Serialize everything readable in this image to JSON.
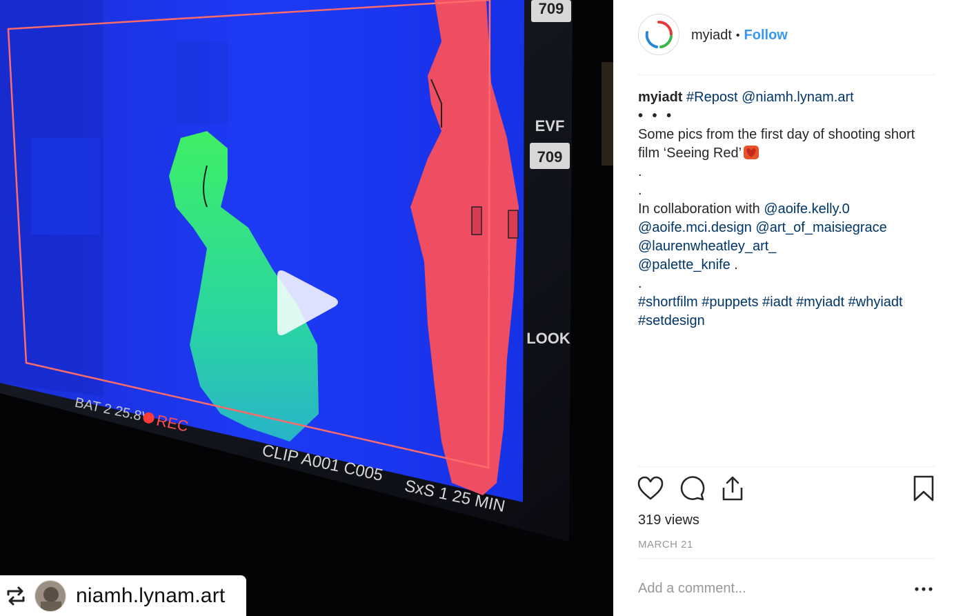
{
  "post": {
    "media": {
      "type": "video",
      "overlay_texts": {
        "frame_top": "709",
        "evf": "EVF",
        "evf_value": "709",
        "look": "LOOK",
        "battery": "BAT 2 25.8V",
        "rec": "REC",
        "clip": "CLIP A001 C005",
        "media_remaining": "SxS 1 25 MIN"
      },
      "repost_tag": {
        "username": "niamh.lynam.art",
        "icon": "repost-icon"
      },
      "play_icon": "play-icon"
    },
    "header": {
      "username": "myiadt",
      "separator": "•",
      "follow_label": "Follow"
    },
    "caption": {
      "username": "myiadt",
      "line1_tag": "#Repost",
      "line1_mention": "@niamh.lynam.art",
      "dots": "• • •",
      "text1": "Some pics from the first day of shooting short",
      "text2": "film ‘Seeing Red’",
      "period1": ".",
      "period2": ".",
      "collab_text": "In collaboration with",
      "mention1": "@aoife.kelly.0",
      "mention2": "@aoife.mci.design",
      "mention3": "@art_of_maisiegrace",
      "mention4": "@laurenwheatley_art_",
      "mention5": "@palette_knife",
      "mention5_suffix": " .",
      "period3": ".",
      "hashtags_line1": [
        "#shortfilm",
        "#puppets",
        "#iadt",
        "#myiadt",
        "#whyiadt"
      ],
      "hashtags_line2": [
        "#setdesign"
      ]
    },
    "stats": {
      "views": "319 views",
      "date": "MARCH 21"
    },
    "comment": {
      "placeholder": "Add a comment..."
    },
    "icons": {
      "like": "heart-icon",
      "comment": "comment-icon",
      "share": "share-icon",
      "save": "bookmark-icon",
      "more": "more-options-icon"
    },
    "colors": {
      "follow": "#3897f0",
      "link": "#003569",
      "muted": "#999999",
      "divider": "#efefef"
    }
  }
}
